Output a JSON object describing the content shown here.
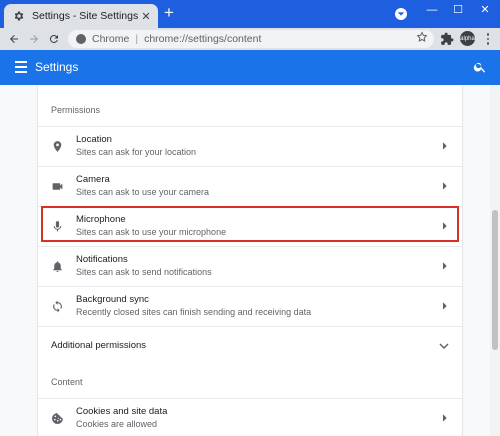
{
  "browser": {
    "tab_title": "Settings - Site Settings",
    "tab_close": "✕",
    "new_tab": "+",
    "window_controls": {
      "minimize": "—",
      "maximize": "☐",
      "close": "✕"
    },
    "omnibox": {
      "site_label": "Chrome",
      "separator": "|",
      "url": "chrome://settings/content"
    },
    "profile_label": "alpha"
  },
  "settings_header": {
    "title": "Settings"
  },
  "permissions": {
    "section_title": "Permissions",
    "items": [
      {
        "label": "Location",
        "subtitle": "Sites can ask for your location",
        "icon": "location-pin-icon"
      },
      {
        "label": "Camera",
        "subtitle": "Sites can ask to use your camera",
        "icon": "camera-icon"
      },
      {
        "label": "Microphone",
        "subtitle": "Sites can ask to use your microphone",
        "icon": "microphone-icon",
        "highlighted": true
      },
      {
        "label": "Notifications",
        "subtitle": "Sites can ask to send notifications",
        "icon": "bell-icon"
      },
      {
        "label": "Background sync",
        "subtitle": "Recently closed sites can finish sending and receiving data",
        "icon": "sync-icon"
      }
    ],
    "additional_label": "Additional permissions"
  },
  "content": {
    "section_title": "Content",
    "items": [
      {
        "label": "Cookies and site data",
        "subtitle": "Cookies are allowed",
        "icon": "cookie-icon"
      }
    ]
  },
  "colors": {
    "tabstrip": "#1e5fe0",
    "appbar": "#1a73e8",
    "highlight": "#d93025"
  }
}
